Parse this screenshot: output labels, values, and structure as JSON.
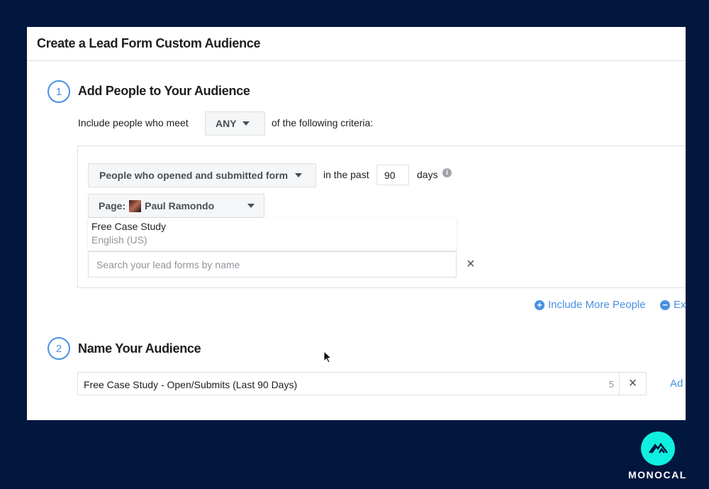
{
  "dialog": {
    "title": "Create a Lead Form Custom Audience"
  },
  "step1": {
    "number": "1",
    "title": "Add People to Your Audience",
    "include_prefix": "Include people who meet",
    "any_select": "ANY",
    "include_suffix": "of the following criteria:",
    "event_select": "People who opened and submitted form",
    "in_the_past": "in the past",
    "days_value": "90",
    "days_label": "days",
    "page_label": "Page:",
    "page_name": "Paul Ramondo",
    "form_item": {
      "name": "Free Case Study",
      "language": "English (US)"
    },
    "search_placeholder": "Search your lead forms by name",
    "include_more": "Include More People",
    "exclude": "Ex"
  },
  "step2": {
    "number": "2",
    "title": "Name Your Audience",
    "name_value": "Free Case Study - Open/Submits (Last 90 Days)",
    "char_count": "5",
    "add_link": "Ad"
  },
  "brand": {
    "name": "MONOCAL",
    "color": "#0ff0e0"
  },
  "colors": {
    "accent": "#4a90e2",
    "background": "#02173e"
  }
}
